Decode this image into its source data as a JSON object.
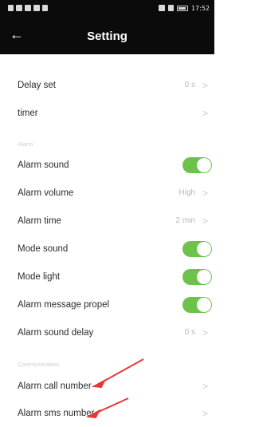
{
  "status_bar": {
    "time": "17:52"
  },
  "header": {
    "title": "Setting"
  },
  "rows": [
    {
      "label": "Delay set",
      "value": "0 s"
    },
    {
      "label": "timer",
      "value": ""
    },
    {
      "label": "Alarm sound",
      "toggle": true
    },
    {
      "label": "Alarm volume",
      "value": "High"
    },
    {
      "label": "Alarm time",
      "value": "2 min"
    },
    {
      "label": "Mode sound",
      "toggle": true
    },
    {
      "label": "Mode light",
      "toggle": true
    },
    {
      "label": "Alarm message propel",
      "toggle": true
    },
    {
      "label": "Alarm sound delay",
      "value": "0 s"
    },
    {
      "label": "Alarm call number",
      "value": ""
    },
    {
      "label": "Alarm sms number",
      "value": ""
    }
  ],
  "sections": {
    "alarm": "Alarm",
    "communication": "Communication"
  },
  "colors": {
    "accent_toggle": "#6cc24a",
    "header_bg": "#0b0b0b",
    "annotation_arrow": "#e53935"
  }
}
